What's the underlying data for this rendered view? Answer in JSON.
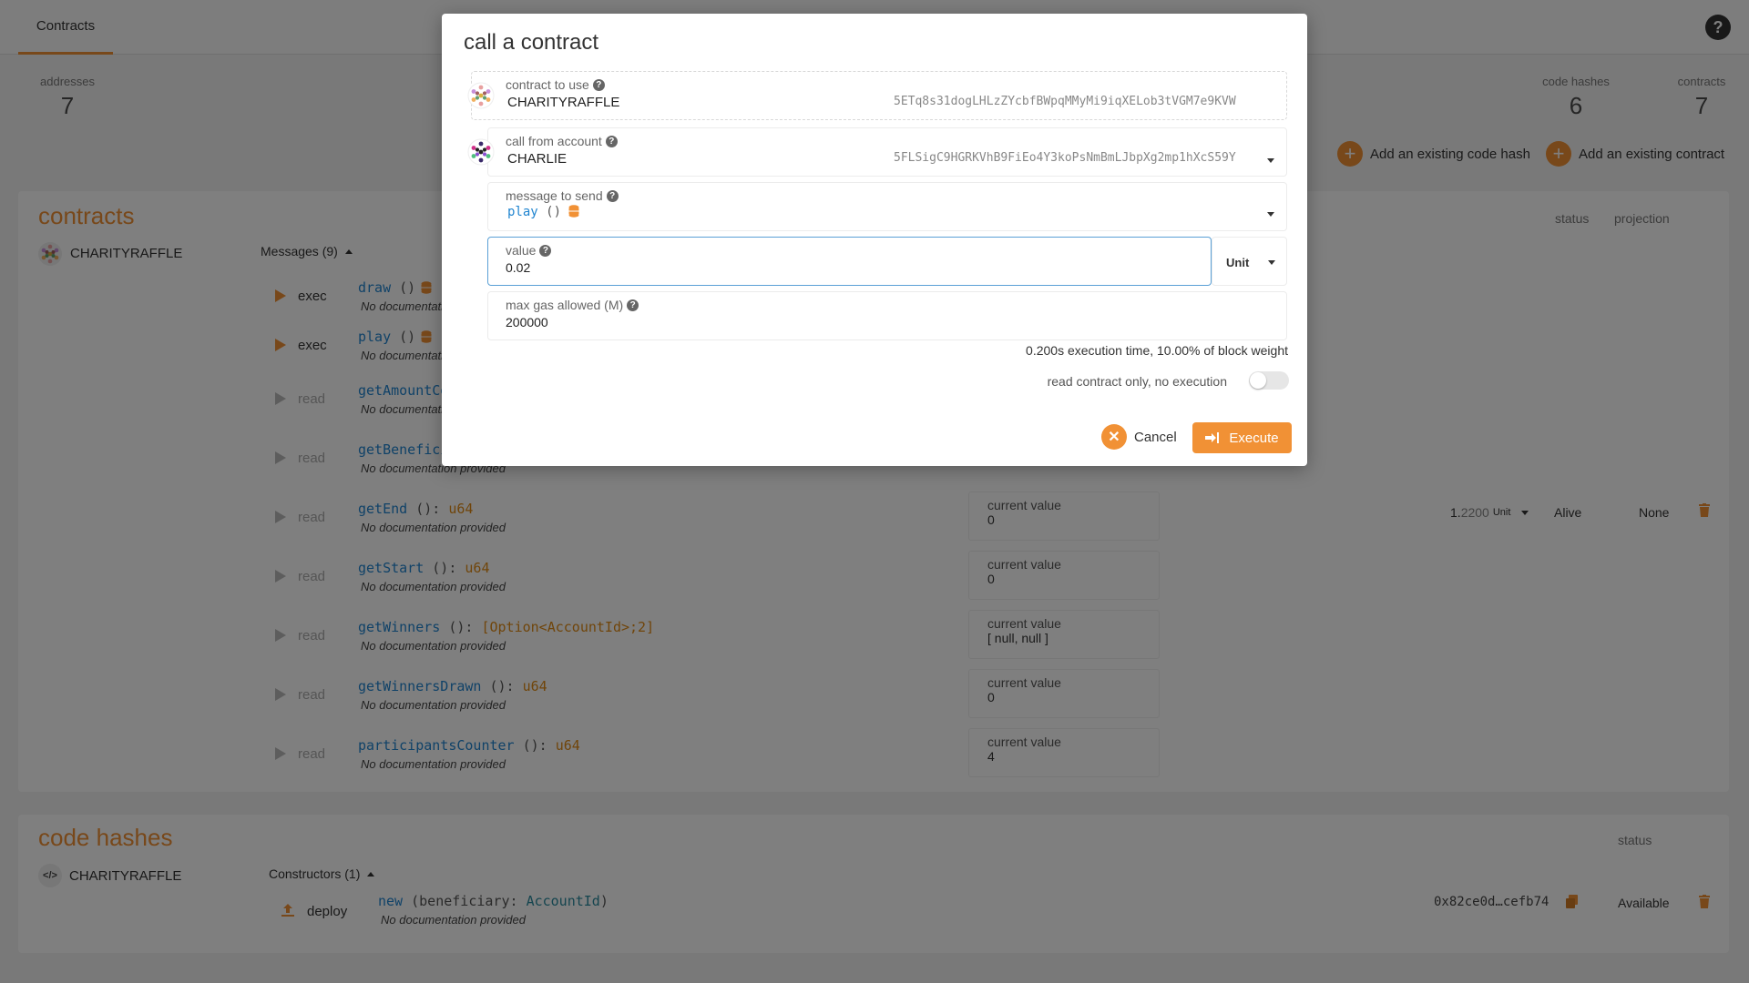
{
  "topbar": {
    "tab": "Contracts",
    "help": "?"
  },
  "summary": {
    "addresses_label": "addresses",
    "addresses_value": "7",
    "code_hashes_label": "code hashes",
    "code_hashes_value": "6",
    "contracts_label": "contracts",
    "contracts_value": "7",
    "add_code_hash": "Add an existing code hash",
    "add_contract": "Add an existing contract"
  },
  "contracts_panel": {
    "title": "contracts",
    "contract_name": "CHARITYRAFFLE",
    "messages_toggle": "Messages (9)",
    "col_status": "status",
    "col_projection": "projection",
    "balance_int": "1.",
    "balance_dec": "2200",
    "balance_unit": "Unit",
    "status_value": "Alive",
    "projection_value": "None",
    "messages": [
      {
        "action": "exec",
        "name": "draw",
        "params": " ()",
        "ret": "",
        "doc": "No documentation provided",
        "current_label": "",
        "current": ""
      },
      {
        "action": "exec",
        "name": "play",
        "params": " ()",
        "ret": "",
        "doc": "No documentation provided",
        "current_label": "",
        "current": ""
      },
      {
        "action": "read",
        "name": "getAmountCollected",
        "params": " ()",
        "ret": "",
        "doc": "No documentation provided",
        "current_label": "",
        "current": ""
      },
      {
        "action": "read",
        "name": "getBeneficiary",
        "params": " ()",
        "ret": "",
        "doc": "No documentation provided",
        "current_label": "",
        "current": ""
      },
      {
        "action": "read",
        "name": "getEnd",
        "params": " ():",
        "ret": " u64",
        "doc": "No documentation provided",
        "current_label": "current value",
        "current": "0"
      },
      {
        "action": "read",
        "name": "getStart",
        "params": " ():",
        "ret": " u64",
        "doc": "No documentation provided",
        "current_label": "current value",
        "current": "0"
      },
      {
        "action": "read",
        "name": "getWinners",
        "params": " ():",
        "ret": " [Option<AccountId>;2]",
        "doc": "No documentation provided",
        "current_label": "current value",
        "current": "[ null, null ]"
      },
      {
        "action": "read",
        "name": "getWinnersDrawn",
        "params": " ():",
        "ret": " u64",
        "doc": "No documentation provided",
        "current_label": "current value",
        "current": "0"
      },
      {
        "action": "read",
        "name": "participantsCounter",
        "params": " ():",
        "ret": " u64",
        "doc": "No documentation provided",
        "current_label": "current value",
        "current": "4"
      }
    ]
  },
  "codehash_panel": {
    "title": "code hashes",
    "name": "CHARITYRAFFLE",
    "constructors_toggle": "Constructors (1)",
    "col_status": "status",
    "action": "deploy",
    "ctor_name": "new",
    "ctor_open": " (beneficiary: ",
    "ctor_type": "AccountId",
    "ctor_close": ")",
    "doc": "No documentation provided",
    "hash": "0x82ce0d…cefb74",
    "status_value": "Available"
  },
  "modal": {
    "title": "call a contract",
    "contract_label": "contract to use",
    "contract_name": "CHARITYRAFFLE",
    "contract_addr": "5ETq8s31dogLHLzZYcbfBWpqMMyMi9iqXELob3tVGM7e9KVW",
    "account_label": "call from account",
    "account_name": "CHARLIE",
    "account_addr": "5FLSigC9HGRKVhB9FiEo4Y3koPsNmBmLJbpXg2mp1hXcS59Y",
    "message_label": "message to send",
    "message_name": "play",
    "message_params": " ()",
    "value_label": "value",
    "value": "0.02",
    "unit": "Unit",
    "gas_label": "max gas allowed (M)",
    "gas": "200000",
    "gas_info": "0.200s execution time, 10.00% of block weight",
    "readonly_label": "read contract only, no execution",
    "cancel": "Cancel",
    "execute": "Execute"
  }
}
